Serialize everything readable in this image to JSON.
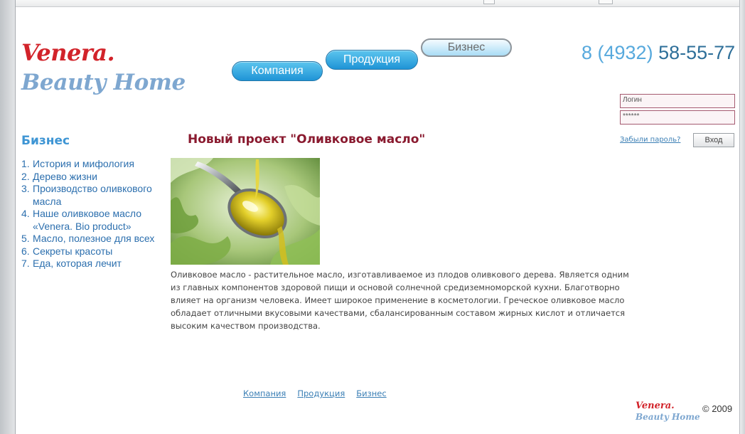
{
  "logo": {
    "line1": "Venera.",
    "line2": "Beauty Home"
  },
  "nav": [
    {
      "label": "Компания"
    },
    {
      "label": "Продукция"
    },
    {
      "label": "Бизнес"
    }
  ],
  "phone": {
    "prefix": "8 (4932) ",
    "number": "58-55-77"
  },
  "login": {
    "username_placeholder": "Логин",
    "password_value": "******",
    "forgot_label": "Забыли пароль?",
    "submit_label": "Вход"
  },
  "sidebar": {
    "title": "Бизнес",
    "items": [
      {
        "num": "1.",
        "label": "История и мифология"
      },
      {
        "num": "2.",
        "label": "Дерево жизни"
      },
      {
        "num": "3.",
        "label": "Производство оливкового масла"
      },
      {
        "num": "4.",
        "label": "Наше оливковое масло «Venera. Bio product»"
      },
      {
        "num": "5.",
        "label": "Масло, полезное для всех"
      },
      {
        "num": "6.",
        "label": "Секреты красоты"
      },
      {
        "num": "7.",
        "label": "Еда, которая лечит"
      }
    ]
  },
  "article": {
    "title": "Новый проект \"Оливковое масло\"",
    "body": "Оливковое масло - растительное масло, изготавливаемое из плодов оливкового дерева. Является одним из главных компонентов здоровой пищи и основой солнечной средиземноморской кухни. Благотворно влияет на организм человека. Имеет широкое применение в косметологии. Греческое оливковое масло обладает отличными вкусовыми качествами, сбалансированным составом жирных кислот и отличается высоким качеством производства."
  },
  "footer": {
    "links": [
      {
        "label": "Компания"
      },
      {
        "label": "Продукция"
      },
      {
        "label": "Бизнес"
      }
    ],
    "logo_line1": "Venera.",
    "logo_line2": "Beauty Home",
    "copyright": "© 2009"
  },
  "colors": {
    "brand_red": "#d2232a",
    "brand_blue": "#7ea7d0",
    "link_blue": "#2c6fae",
    "title_maroon": "#8a1a2f",
    "nav_pill_blue": "#1f94d6"
  }
}
